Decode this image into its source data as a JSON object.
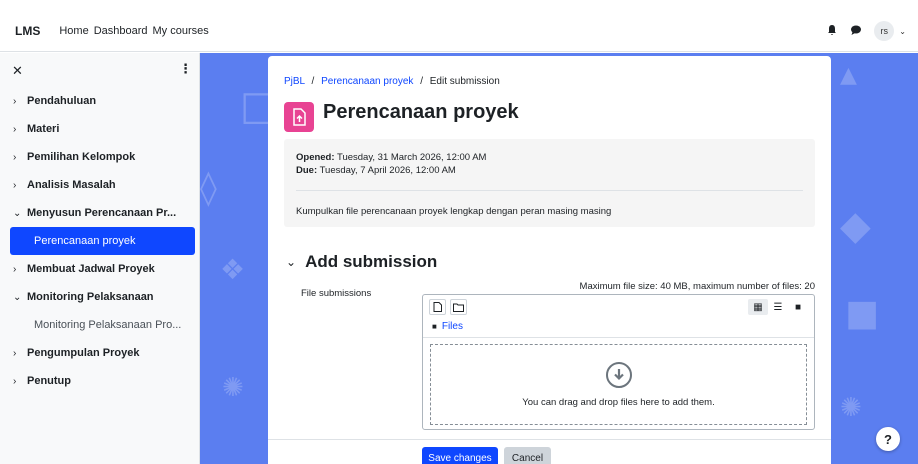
{
  "topnav": {
    "brand": "LMS",
    "links": [
      "Home",
      "Dashboard",
      "My courses"
    ],
    "avatar_initials": "rs"
  },
  "drawer": {
    "items": [
      {
        "label": "Pendahuluan",
        "state": "collapsed"
      },
      {
        "label": "Materi",
        "state": "collapsed"
      },
      {
        "label": "Pemilihan Kelompok",
        "state": "collapsed"
      },
      {
        "label": "Analisis Masalah",
        "state": "collapsed"
      },
      {
        "label": "Menyusun Perencanaan Pr...",
        "state": "expanded"
      },
      {
        "label": "Perencanaan proyek",
        "state": "active"
      },
      {
        "label": "Membuat Jadwal Proyek",
        "state": "collapsed"
      },
      {
        "label": "Monitoring Pelaksanaan",
        "state": "expanded"
      },
      {
        "label": "Monitoring Pelaksanaan Pro...",
        "state": "sub"
      },
      {
        "label": "Pengumpulan Proyek",
        "state": "collapsed"
      },
      {
        "label": "Penutup",
        "state": "collapsed"
      }
    ]
  },
  "breadcrumb": {
    "course": "PjBL",
    "activity": "Perencanaan proyek",
    "current": "Edit submission",
    "separator": "/"
  },
  "page": {
    "title": "Perencanaan proyek",
    "icon_color": "#e84393"
  },
  "dates": {
    "opened_label": "Opened:",
    "opened_value": "Tuesday, 31 March 2026, 12:00 AM",
    "due_label": "Due:",
    "due_value": "Tuesday, 7 April 2026, 12:00 AM"
  },
  "description": "Kumpulkan file perencanaan proyek lengkap dengan peran masing masing",
  "submission": {
    "heading": "Add submission",
    "field_label": "File submissions",
    "max_info": "Maximum file size: 40 MB, maximum number of files: 20",
    "path_label": "Files",
    "drop_text": "You can drag and drop files here to add them."
  },
  "buttons": {
    "save": "Save changes",
    "cancel": "Cancel"
  },
  "help_label": "?",
  "colors": {
    "primary": "#0f47ff",
    "background": "#5b7ef0"
  }
}
